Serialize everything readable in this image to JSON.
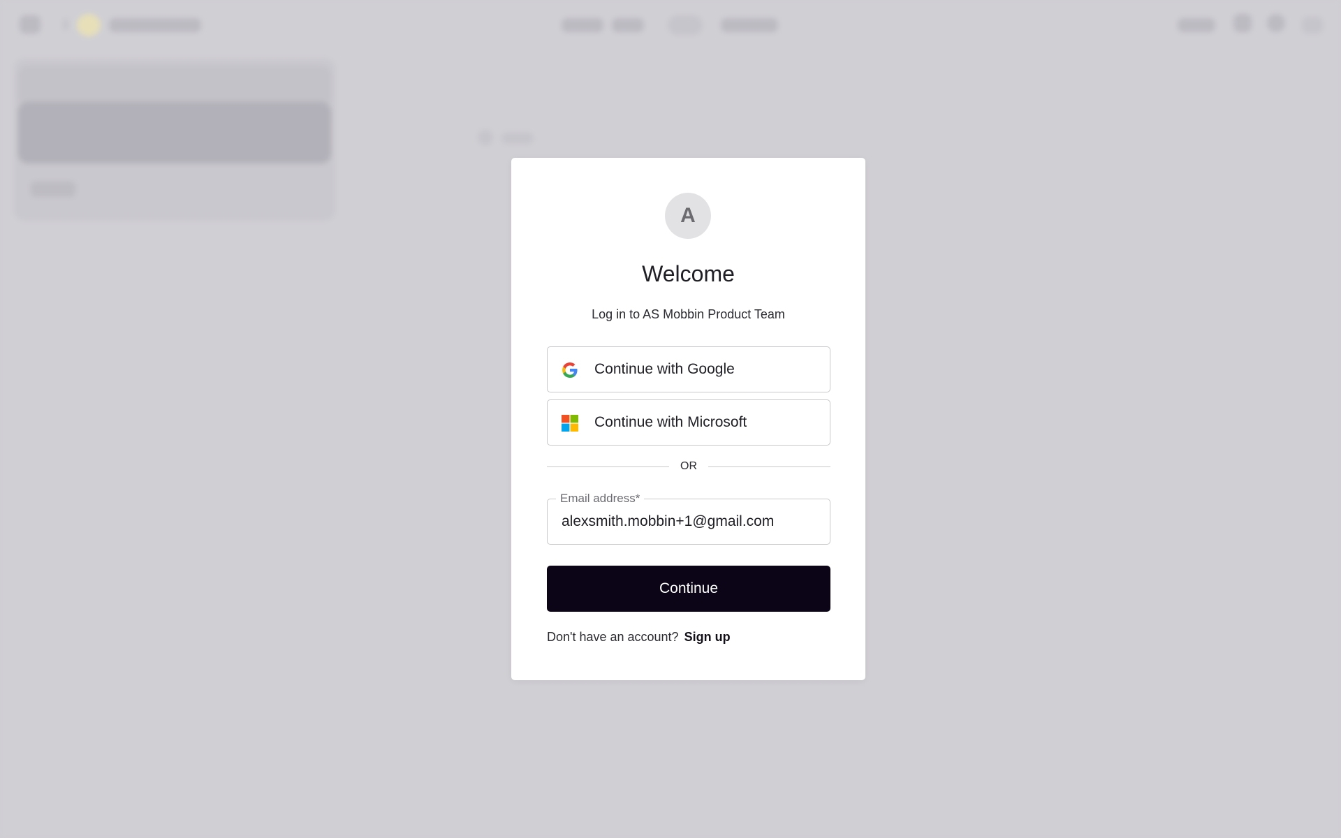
{
  "modal": {
    "avatar_letter": "A",
    "title": "Welcome",
    "subtitle": "Log in to AS Mobbin Product Team",
    "google_label": "Continue with Google",
    "microsoft_label": "Continue with Microsoft",
    "divider_text": "OR",
    "email": {
      "label": "Email address",
      "required_mark": "*",
      "value": "alexsmith.mobbin+1@gmail.com"
    },
    "continue_label": "Continue",
    "footer_prompt": "Don't have an account?",
    "signup_label": "Sign up"
  },
  "icons": {
    "google": "google-logo-icon",
    "microsoft": "microsoft-logo-icon"
  },
  "colors": {
    "backdrop": "#cfced3",
    "primary_button": "#0c0517",
    "google_blue": "#4285F4",
    "google_green": "#34A853",
    "google_yellow": "#FBBC05",
    "google_red": "#EA4335",
    "ms_red": "#F25022",
    "ms_green": "#7FBA00",
    "ms_blue": "#00A4EF",
    "ms_yellow": "#FFB900"
  }
}
